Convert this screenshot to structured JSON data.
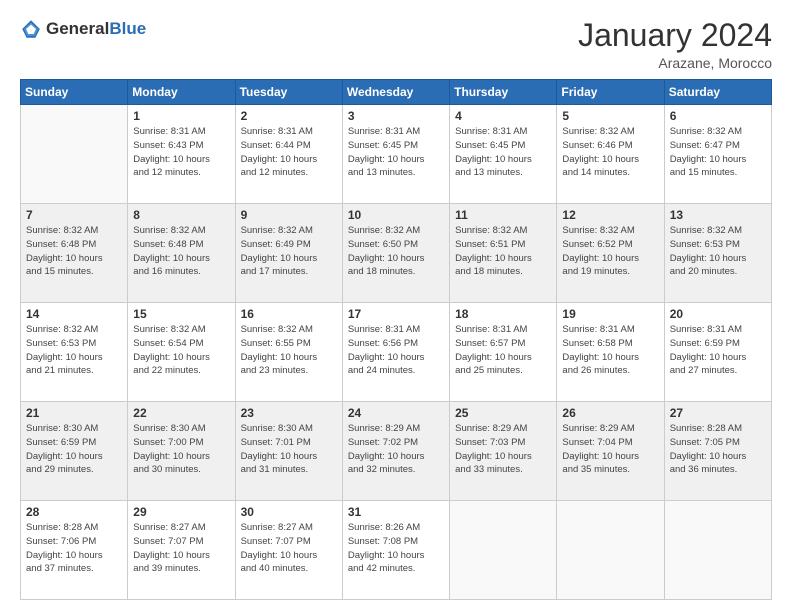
{
  "logo": {
    "general": "General",
    "blue": "Blue"
  },
  "header": {
    "month": "January 2024",
    "location": "Arazane, Morocco"
  },
  "weekdays": [
    "Sunday",
    "Monday",
    "Tuesday",
    "Wednesday",
    "Thursday",
    "Friday",
    "Saturday"
  ],
  "weeks": [
    [
      {
        "day": "",
        "sunrise": "",
        "sunset": "",
        "daylight": ""
      },
      {
        "day": "1",
        "sunrise": "Sunrise: 8:31 AM",
        "sunset": "Sunset: 6:43 PM",
        "daylight": "Daylight: 10 hours and 12 minutes."
      },
      {
        "day": "2",
        "sunrise": "Sunrise: 8:31 AM",
        "sunset": "Sunset: 6:44 PM",
        "daylight": "Daylight: 10 hours and 12 minutes."
      },
      {
        "day": "3",
        "sunrise": "Sunrise: 8:31 AM",
        "sunset": "Sunset: 6:45 PM",
        "daylight": "Daylight: 10 hours and 13 minutes."
      },
      {
        "day": "4",
        "sunrise": "Sunrise: 8:31 AM",
        "sunset": "Sunset: 6:45 PM",
        "daylight": "Daylight: 10 hours and 13 minutes."
      },
      {
        "day": "5",
        "sunrise": "Sunrise: 8:32 AM",
        "sunset": "Sunset: 6:46 PM",
        "daylight": "Daylight: 10 hours and 14 minutes."
      },
      {
        "day": "6",
        "sunrise": "Sunrise: 8:32 AM",
        "sunset": "Sunset: 6:47 PM",
        "daylight": "Daylight: 10 hours and 15 minutes."
      }
    ],
    [
      {
        "day": "7",
        "sunrise": "Sunrise: 8:32 AM",
        "sunset": "Sunset: 6:48 PM",
        "daylight": "Daylight: 10 hours and 15 minutes."
      },
      {
        "day": "8",
        "sunrise": "Sunrise: 8:32 AM",
        "sunset": "Sunset: 6:48 PM",
        "daylight": "Daylight: 10 hours and 16 minutes."
      },
      {
        "day": "9",
        "sunrise": "Sunrise: 8:32 AM",
        "sunset": "Sunset: 6:49 PM",
        "daylight": "Daylight: 10 hours and 17 minutes."
      },
      {
        "day": "10",
        "sunrise": "Sunrise: 8:32 AM",
        "sunset": "Sunset: 6:50 PM",
        "daylight": "Daylight: 10 hours and 18 minutes."
      },
      {
        "day": "11",
        "sunrise": "Sunrise: 8:32 AM",
        "sunset": "Sunset: 6:51 PM",
        "daylight": "Daylight: 10 hours and 18 minutes."
      },
      {
        "day": "12",
        "sunrise": "Sunrise: 8:32 AM",
        "sunset": "Sunset: 6:52 PM",
        "daylight": "Daylight: 10 hours and 19 minutes."
      },
      {
        "day": "13",
        "sunrise": "Sunrise: 8:32 AM",
        "sunset": "Sunset: 6:53 PM",
        "daylight": "Daylight: 10 hours and 20 minutes."
      }
    ],
    [
      {
        "day": "14",
        "sunrise": "Sunrise: 8:32 AM",
        "sunset": "Sunset: 6:53 PM",
        "daylight": "Daylight: 10 hours and 21 minutes."
      },
      {
        "day": "15",
        "sunrise": "Sunrise: 8:32 AM",
        "sunset": "Sunset: 6:54 PM",
        "daylight": "Daylight: 10 hours and 22 minutes."
      },
      {
        "day": "16",
        "sunrise": "Sunrise: 8:32 AM",
        "sunset": "Sunset: 6:55 PM",
        "daylight": "Daylight: 10 hours and 23 minutes."
      },
      {
        "day": "17",
        "sunrise": "Sunrise: 8:31 AM",
        "sunset": "Sunset: 6:56 PM",
        "daylight": "Daylight: 10 hours and 24 minutes."
      },
      {
        "day": "18",
        "sunrise": "Sunrise: 8:31 AM",
        "sunset": "Sunset: 6:57 PM",
        "daylight": "Daylight: 10 hours and 25 minutes."
      },
      {
        "day": "19",
        "sunrise": "Sunrise: 8:31 AM",
        "sunset": "Sunset: 6:58 PM",
        "daylight": "Daylight: 10 hours and 26 minutes."
      },
      {
        "day": "20",
        "sunrise": "Sunrise: 8:31 AM",
        "sunset": "Sunset: 6:59 PM",
        "daylight": "Daylight: 10 hours and 27 minutes."
      }
    ],
    [
      {
        "day": "21",
        "sunrise": "Sunrise: 8:30 AM",
        "sunset": "Sunset: 6:59 PM",
        "daylight": "Daylight: 10 hours and 29 minutes."
      },
      {
        "day": "22",
        "sunrise": "Sunrise: 8:30 AM",
        "sunset": "Sunset: 7:00 PM",
        "daylight": "Daylight: 10 hours and 30 minutes."
      },
      {
        "day": "23",
        "sunrise": "Sunrise: 8:30 AM",
        "sunset": "Sunset: 7:01 PM",
        "daylight": "Daylight: 10 hours and 31 minutes."
      },
      {
        "day": "24",
        "sunrise": "Sunrise: 8:29 AM",
        "sunset": "Sunset: 7:02 PM",
        "daylight": "Daylight: 10 hours and 32 minutes."
      },
      {
        "day": "25",
        "sunrise": "Sunrise: 8:29 AM",
        "sunset": "Sunset: 7:03 PM",
        "daylight": "Daylight: 10 hours and 33 minutes."
      },
      {
        "day": "26",
        "sunrise": "Sunrise: 8:29 AM",
        "sunset": "Sunset: 7:04 PM",
        "daylight": "Daylight: 10 hours and 35 minutes."
      },
      {
        "day": "27",
        "sunrise": "Sunrise: 8:28 AM",
        "sunset": "Sunset: 7:05 PM",
        "daylight": "Daylight: 10 hours and 36 minutes."
      }
    ],
    [
      {
        "day": "28",
        "sunrise": "Sunrise: 8:28 AM",
        "sunset": "Sunset: 7:06 PM",
        "daylight": "Daylight: 10 hours and 37 minutes."
      },
      {
        "day": "29",
        "sunrise": "Sunrise: 8:27 AM",
        "sunset": "Sunset: 7:07 PM",
        "daylight": "Daylight: 10 hours and 39 minutes."
      },
      {
        "day": "30",
        "sunrise": "Sunrise: 8:27 AM",
        "sunset": "Sunset: 7:07 PM",
        "daylight": "Daylight: 10 hours and 40 minutes."
      },
      {
        "day": "31",
        "sunrise": "Sunrise: 8:26 AM",
        "sunset": "Sunset: 7:08 PM",
        "daylight": "Daylight: 10 hours and 42 minutes."
      },
      {
        "day": "",
        "sunrise": "",
        "sunset": "",
        "daylight": ""
      },
      {
        "day": "",
        "sunrise": "",
        "sunset": "",
        "daylight": ""
      },
      {
        "day": "",
        "sunrise": "",
        "sunset": "",
        "daylight": ""
      }
    ]
  ]
}
